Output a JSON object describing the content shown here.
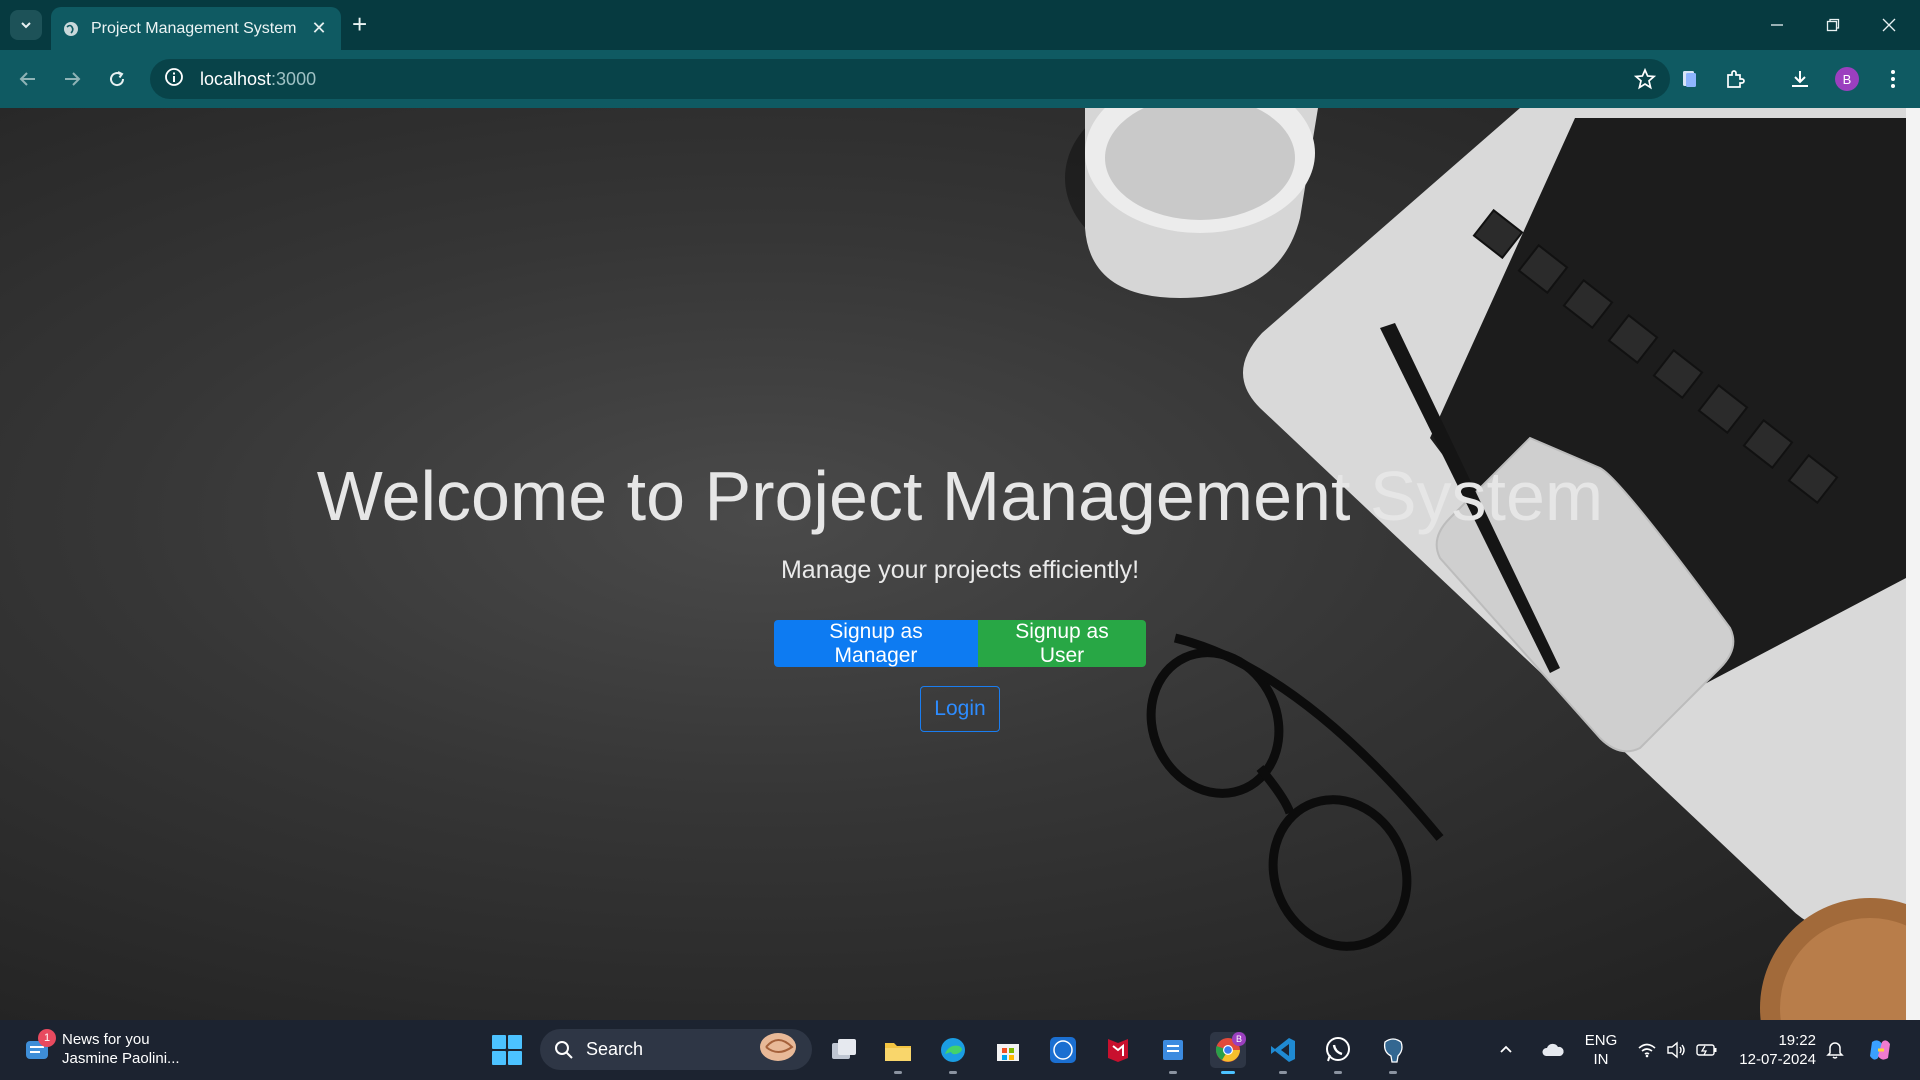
{
  "browser": {
    "tab_title": "Project Management System",
    "new_tab_symbol": "+",
    "url_host": "localhost",
    "url_port": ":3000",
    "profile_initial": "B"
  },
  "page": {
    "title": "Welcome to Project Management System",
    "subtitle": "Manage your projects efficiently!",
    "signup_manager_label": "Signup as Manager",
    "signup_user_label": "Signup as User",
    "login_label": "Login"
  },
  "taskbar": {
    "news_title": "News for you",
    "news_subtitle": "Jasmine Paolini...",
    "news_badge": "1",
    "search_label": "Search",
    "lang_line1": "ENG",
    "lang_line2": "IN",
    "time": "19:22",
    "date": "12-07-2024",
    "chrome_badge": "B"
  },
  "colors": {
    "chrome_tab_bg": "#063a40",
    "chrome_toolbar_bg": "#0f5a62",
    "primary_button": "#0d7bf2",
    "success_button": "#28a745",
    "login_outline": "#1a7df0",
    "taskbar_bg": "#1c2330"
  }
}
